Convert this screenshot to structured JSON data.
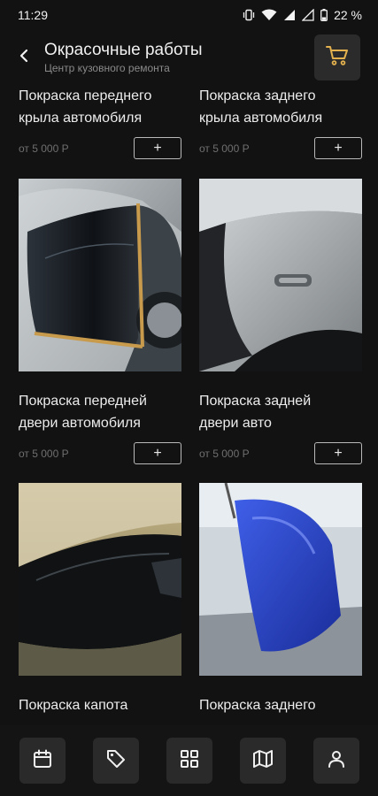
{
  "status_bar": {
    "time": "11:29",
    "battery": "22 %"
  },
  "header": {
    "title": "Окрасочные работы",
    "subtitle": "Центр кузовного ремонта",
    "back_icon": "chevron-left-icon",
    "cart_icon": "cart-icon"
  },
  "products": [
    {
      "title_line1": "Покраска переднего",
      "title_line2": "крыла автомобиля",
      "price": "от 5 000 Р",
      "add_label": "+",
      "image": ""
    },
    {
      "title_line1": "Покраска заднего",
      "title_line2": "крыла автомобиля",
      "price": "от 5 000 Р",
      "add_label": "+",
      "image": ""
    },
    {
      "title_line1": "Покраска передней",
      "title_line2": "двери автомобиля",
      "price": "от 5 000 Р",
      "add_label": "+",
      "image": "black car door masked with tape"
    },
    {
      "title_line1": "Покраска задней",
      "title_line2": "двери авто",
      "price": "от 5 000 Р",
      "add_label": "+",
      "image": "silver car rear door covered with film"
    },
    {
      "title_line1": "Покраска капота",
      "title_line2": "",
      "price": "",
      "add_label": "",
      "image": "black car hood under masking film"
    },
    {
      "title_line1": "Покраска заднего",
      "title_line2": "",
      "price": "",
      "add_label": "",
      "image": "blue bumper in paint booth"
    }
  ],
  "bottom_nav": [
    {
      "icon": "calendar-icon"
    },
    {
      "icon": "tag-icon"
    },
    {
      "icon": "grid-icon"
    },
    {
      "icon": "map-icon"
    },
    {
      "icon": "user-icon"
    }
  ],
  "colors": {
    "background": "#121212",
    "button_bg": "#2a2a2a",
    "text": "#ececec",
    "muted": "#6f6f6f",
    "cart_accent": "#e3b24f"
  }
}
